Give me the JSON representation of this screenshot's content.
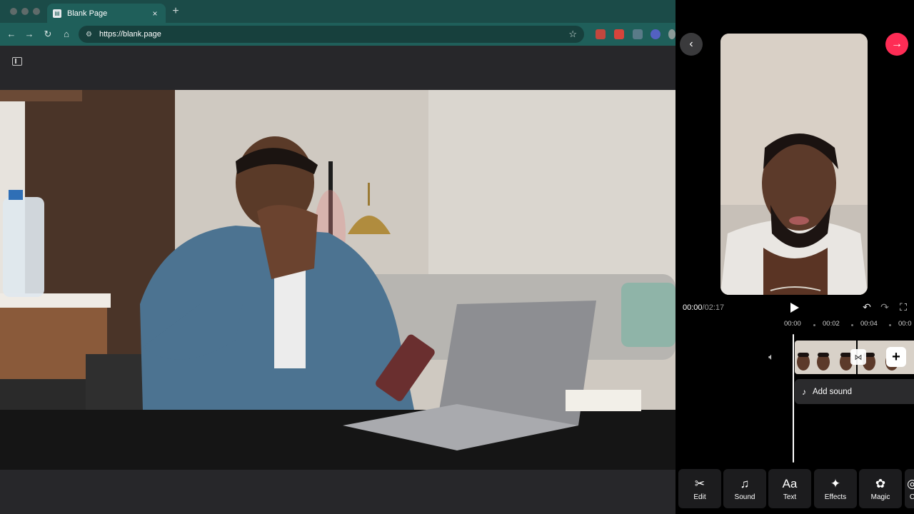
{
  "browser": {
    "tab_title": "Blank Page",
    "tab_close": "×",
    "new_tab": "+",
    "url": "https://blank.page"
  },
  "editor": {
    "time_current": "00:00",
    "time_separator": "/",
    "time_total": "02:17",
    "ruler": [
      "00:00",
      "00:02",
      "00:04",
      "00:0"
    ],
    "add_sound_label": "Add sound",
    "tools": [
      {
        "label": "Edit",
        "icon": "scissors-icon",
        "glyph": "✂"
      },
      {
        "label": "Sound",
        "icon": "music-note-icon",
        "glyph": "♫"
      },
      {
        "label": "Text",
        "icon": "text-icon",
        "glyph": "Aa"
      },
      {
        "label": "Effects",
        "icon": "sparkle-icon",
        "glyph": "✦"
      },
      {
        "label": "Magic",
        "icon": "magic-icon",
        "glyph": "✿"
      },
      {
        "label": "C",
        "icon": "more-tool-icon",
        "glyph": "◎"
      }
    ]
  },
  "colors": {
    "tab_strip": "#1b4b48",
    "toolbar": "#1f5f5a",
    "accent_next": "#fe2c55",
    "editor_bg": "#000000"
  }
}
